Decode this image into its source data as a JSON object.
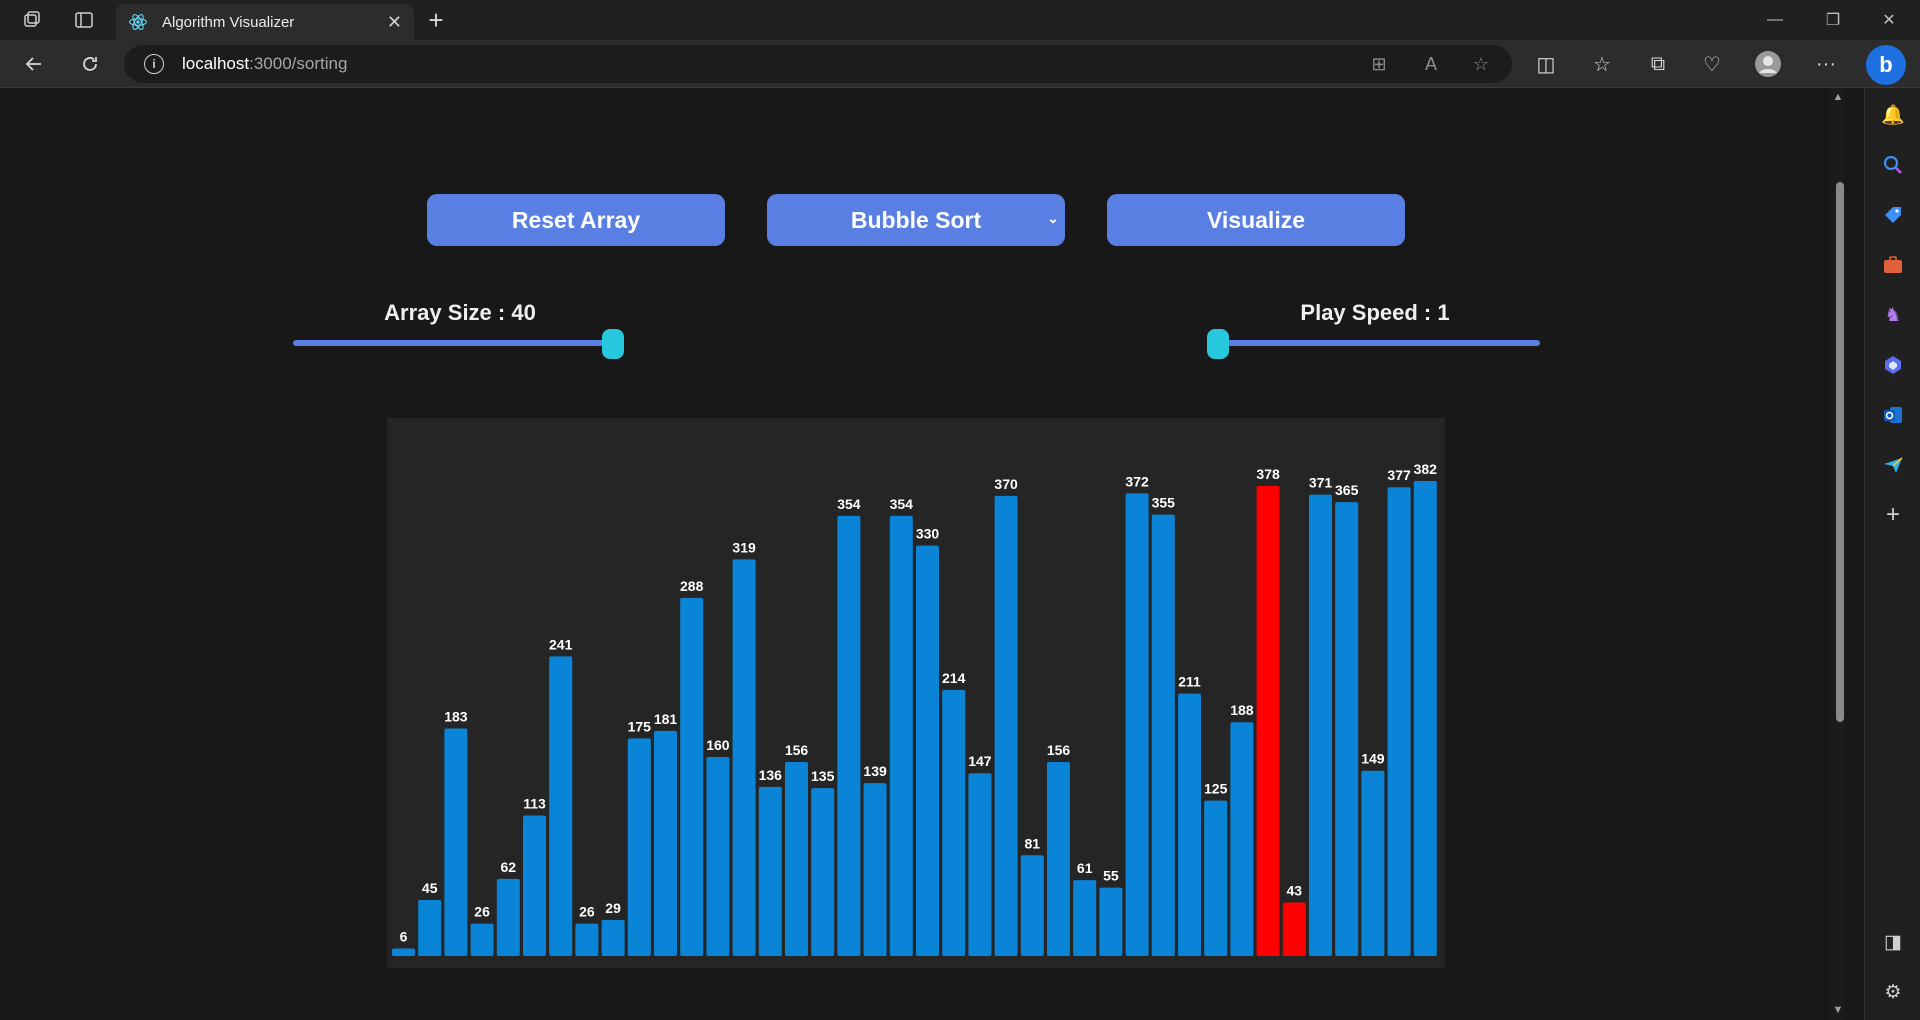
{
  "browser": {
    "tab_title": "Algorithm Visualizer",
    "url_host": "localhost",
    "url_path": ":3000/sorting"
  },
  "controls": {
    "reset_label": "Reset Array",
    "algorithm_selected": "Bubble Sort",
    "visualize_label": "Visualize",
    "array_size_label": "Array Size : 40",
    "array_size_value": 40,
    "play_speed_label": "Play Speed : 1",
    "play_speed_value": 1
  },
  "colors": {
    "bar": "#0a84d6",
    "bar_compare": "#ff0000",
    "button": "#5a7fe3",
    "slider_thumb": "#27c8dd",
    "page_bg": "#181818",
    "chart_bg": "#252525"
  },
  "chart_data": {
    "type": "bar",
    "values": [
      6,
      45,
      183,
      26,
      62,
      113,
      241,
      26,
      29,
      175,
      181,
      288,
      160,
      319,
      136,
      156,
      135,
      354,
      139,
      354,
      330,
      214,
      147,
      370,
      81,
      156,
      61,
      55,
      372,
      355,
      211,
      125,
      188,
      378,
      43,
      371,
      365,
      149,
      377,
      382
    ],
    "highlighted_indices": [
      33,
      34
    ],
    "ylim": [
      0,
      382
    ]
  }
}
